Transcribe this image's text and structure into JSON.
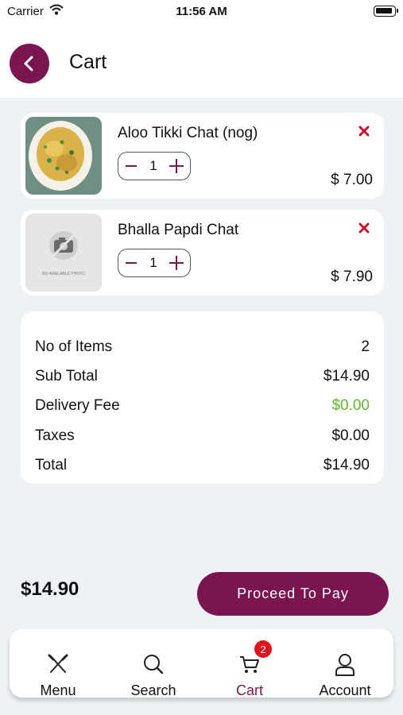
{
  "status_bar": {
    "carrier": "Carrier",
    "time": "11:56 AM"
  },
  "header": {
    "title": "Cart"
  },
  "items": [
    {
      "name": "Aloo Tikki Chat (nog)",
      "quantity": "1",
      "price": "$ 7.00"
    },
    {
      "name": "Bhalla Papdi Chat",
      "quantity": "1",
      "price": "$ 7.90",
      "placeholder_text": "NO AVAILABLE PHOTO"
    }
  ],
  "summary": {
    "rows": [
      {
        "label": "No of Items",
        "value": "2"
      },
      {
        "label": "Sub Total",
        "value": "$14.90"
      },
      {
        "label": "Delivery Fee",
        "value": "$0.00"
      },
      {
        "label": "Taxes",
        "value": "$0.00"
      },
      {
        "label": "Total",
        "value": "$14.90"
      }
    ]
  },
  "footer": {
    "total": "$14.90",
    "proceed_label": "Proceed To Pay"
  },
  "tabbar": {
    "tabs": [
      {
        "label": "Menu",
        "icon": "utensils-icon"
      },
      {
        "label": "Search",
        "icon": "search-icon"
      },
      {
        "label": "Cart",
        "icon": "cart-icon",
        "badge": "2",
        "active": true
      },
      {
        "label": "Account",
        "icon": "user-icon"
      }
    ]
  },
  "colors": {
    "accent": "#7a1552",
    "remove": "#c8102e",
    "free": "#5cb82e",
    "badge": "#e0131c",
    "background": "#eef2f7"
  }
}
